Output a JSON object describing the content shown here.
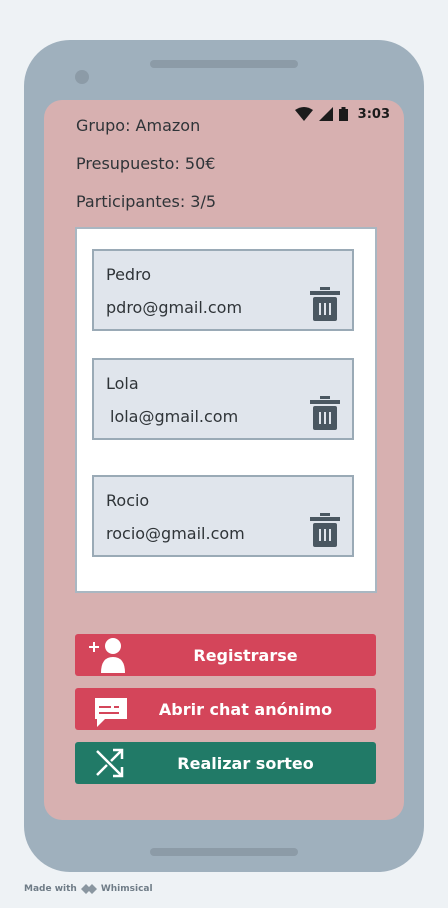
{
  "status_bar": {
    "time": "3:03",
    "icons": [
      "wifi-icon",
      "signal-icon",
      "battery-icon"
    ]
  },
  "group": {
    "name_label": "Grupo: Amazon",
    "budget_label": "Presupuesto: 50€",
    "participants_label": "Participantes: 3/5"
  },
  "participants": [
    {
      "name": "Pedro",
      "email": "pdro@gmail.com",
      "icon": "trash-icon"
    },
    {
      "name": "Lola",
      "email": "lola@gmail.com",
      "icon": "trash-icon"
    },
    {
      "name": "Rocio",
      "email": "rocio@gmail.com",
      "icon": "trash-icon"
    }
  ],
  "actions": {
    "register": {
      "label": "Registrarse",
      "icon": "add-user-icon"
    },
    "chat": {
      "label": "Abrir chat anónimo",
      "icon": "chat-icon"
    },
    "draw": {
      "label": "Realizar sorteo",
      "icon": "shuffle-icon"
    }
  },
  "colors": {
    "screen_bg": "#d7b0b0",
    "primary": "#d4455a",
    "secondary": "#217a67",
    "card_bg": "#e0e5ec"
  },
  "footer": {
    "made_with": "Made with",
    "brand": "Whimsical"
  }
}
